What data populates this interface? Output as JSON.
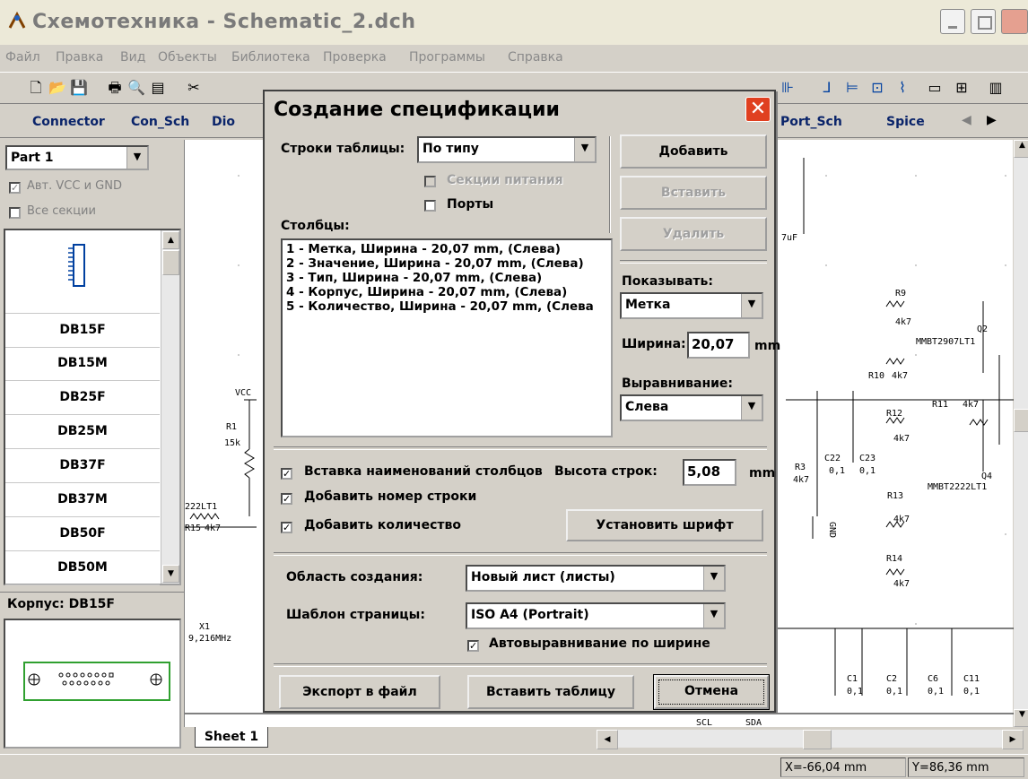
{
  "window": {
    "title": "Схемотехника - Schematic_2.dch"
  },
  "menu": [
    "Файл",
    "Правка",
    "Вид",
    "Объекты",
    "Библиотека",
    "Проверка",
    "Программы",
    "Справка"
  ],
  "component_tabs": [
    "Connector",
    "Con_Sch",
    "Dio",
    "Port_Sch",
    "Spice"
  ],
  "left_panel": {
    "part_select": "Part 1",
    "auto_vcc_label": "Авт. VCC и GND",
    "all_sections_label": "Все секции",
    "parts": [
      "DB15F",
      "DB15M",
      "DB25F",
      "DB25M",
      "DB37F",
      "DB37M",
      "DB50F",
      "DB50M"
    ],
    "package_label": "Корпус: DB15F"
  },
  "canvas": {
    "sheet_tab": "Sheet 1",
    "labels": [
      "VCC",
      "R1",
      "15k",
      "222LT1",
      "R15",
      "4k7",
      "X1",
      "9,216MHz",
      "7uF",
      "R9",
      "4k7",
      "Q2",
      "MMBT2907LT1",
      "R10",
      "4k7",
      "R11",
      "4k7",
      "R12",
      "4k7",
      "R3",
      "4k7",
      "C22",
      "0,1",
      "C23",
      "0,1",
      "Q4",
      "MMBT2222LT1",
      "R13",
      "4k7",
      "GND",
      "R14",
      "4k7",
      "C1",
      "0,1",
      "C2",
      "0,1",
      "C6",
      "0,1",
      "C11",
      "0,1",
      "SCL",
      "SDA"
    ]
  },
  "status": {
    "x": "X=-66,04 mm",
    "y": "Y=86,36 mm"
  },
  "dialog": {
    "title": "Создание спецификации",
    "rows_label": "Строки таблицы:",
    "rows_value": "По типу",
    "power_sections_label": "Секции питания",
    "ports_label": "Порты",
    "columns_label": "Столбцы:",
    "columns": [
      "1 - Метка, Ширина - 20,07 mm, (Слева)",
      "2 - Значение, Ширина - 20,07 mm, (Слева)",
      "3 - Тип, Ширина - 20,07 mm, (Слева)",
      "4 - Корпус, Ширина - 20,07 mm, (Слева)",
      "5 - Количество, Ширина - 20,07 mm, (Слева"
    ],
    "add_button": "Добавить",
    "insert_button": "Вставить",
    "delete_button": "Удалить",
    "show_label": "Показывать:",
    "show_value": "Метка",
    "width_label": "Ширина:",
    "width_value": "20,07",
    "width_unit": "mm",
    "align_label": "Выравнивание:",
    "align_value": "Слева",
    "insert_column_names_label": "Вставка наименований столбцов",
    "row_height_label": "Высота строк:",
    "row_height_value": "5,08",
    "row_height_unit": "mm",
    "add_row_number_label": "Добавить номер строки",
    "add_quantity_label": "Добавить количество",
    "set_font_button": "Установить шрифт",
    "area_label": "Область создания:",
    "area_value": "Новый лист (листы)",
    "template_label": "Шаблон страницы:",
    "template_value": "ISO A4 (Portrait)",
    "auto_align_width_label": "Автовыравнивание по ширине",
    "export_button": "Экспорт в файл",
    "insert_table_button": "Вставить таблицу",
    "cancel_button": "Отмена"
  }
}
